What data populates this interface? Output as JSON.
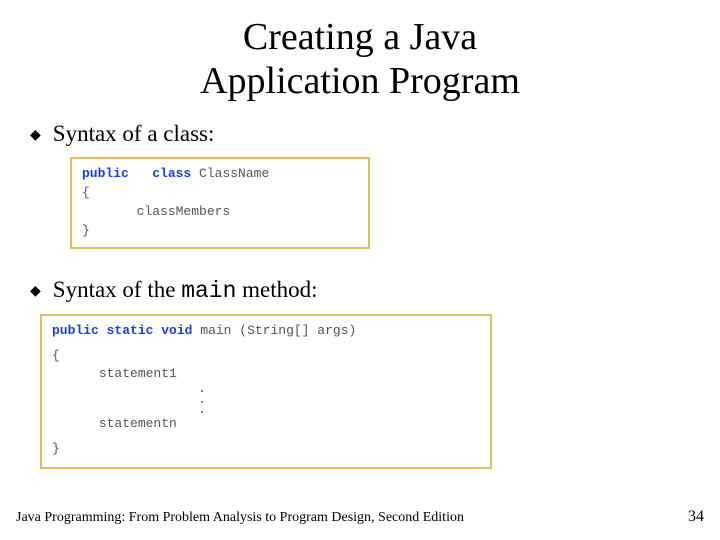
{
  "title_line1": "Creating a Java",
  "title_line2": "Application Program",
  "bullet1": "Syntax of a class:",
  "bullet2_pre": "Syntax of the ",
  "bullet2_code": "main",
  "bullet2_post": " method:",
  "code1": {
    "kw_public": "public",
    "kw_class": "class",
    "classname": "ClassName",
    "brace_open": "{",
    "members": "classMembers",
    "brace_close": "}"
  },
  "code2": {
    "kw_public": "public",
    "kw_static": "static",
    "kw_void": "void",
    "sig_rest": " main (String[] args)",
    "brace_open": "{",
    "stmt1": "statement1",
    "stmtn": "statementn",
    "dot": ".",
    "brace_close": "}"
  },
  "footer_text": "Java Programming: From Problem Analysis to Program Design, Second Edition",
  "page_number": "34"
}
